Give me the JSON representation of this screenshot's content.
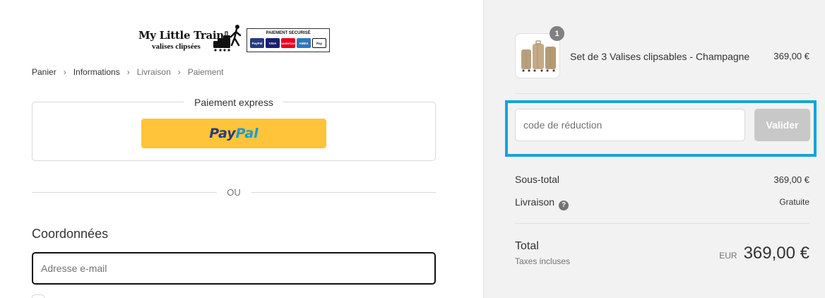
{
  "brand": {
    "name": "My Little Train",
    "tagline": "valises clipsées",
    "secure_label": "PAIEMENT SECURISÉ",
    "payment_icons": [
      "PayPal",
      "VISA",
      "mastercard",
      "AMEX",
      "Pay"
    ]
  },
  "breadcrumb": {
    "items": [
      {
        "label": "Panier"
      },
      {
        "label": "Informations"
      },
      {
        "label": "Livraison"
      },
      {
        "label": "Paiement"
      }
    ]
  },
  "express": {
    "title": "Paiement express",
    "paypal_part1": "Pay",
    "paypal_part2": "Pal"
  },
  "divider_label": "OU",
  "contact": {
    "title": "Coordonnées",
    "email_placeholder": "Adresse e-mail"
  },
  "order": {
    "quantity_badge": "1",
    "product_name": "Set de 3 Valises clipsables - Champagne",
    "product_price": "369,00 €"
  },
  "discount": {
    "placeholder": "code de réduction",
    "button_label": "Valider"
  },
  "summary": {
    "subtotal_label": "Sous-total",
    "subtotal_value": "369,00 €",
    "shipping_label": "Livraison",
    "shipping_value": "Gratuite",
    "total_label": "Total",
    "taxes_label": "Taxes incluses",
    "currency": "EUR",
    "total_value": "369,00 €"
  },
  "colors": {
    "highlight": "#16a4d6",
    "paypal_yellow": "#ffc439",
    "button_disabled": "#c8c8c8",
    "sidebar_bg": "#f2f2f2"
  }
}
